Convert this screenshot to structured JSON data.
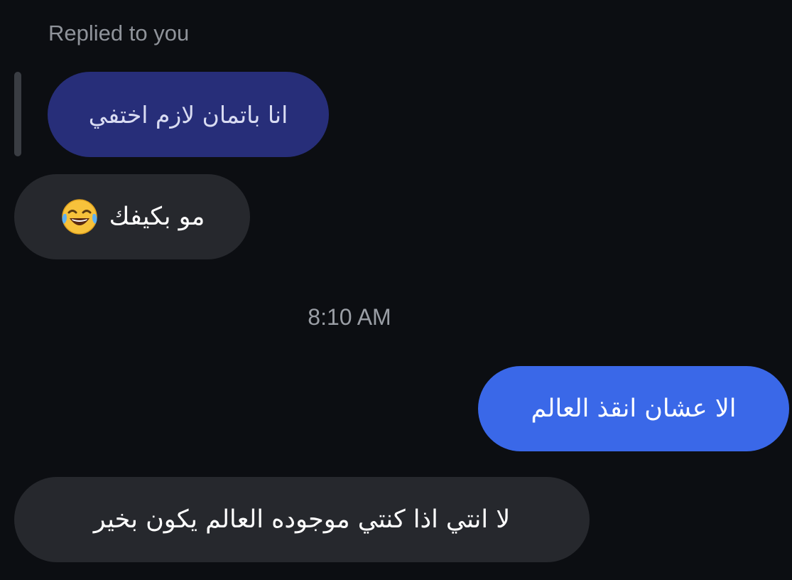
{
  "reply": {
    "label": "Replied to you",
    "quoted_text": "انا باتمان لازم اختفي"
  },
  "messages": [
    {
      "direction": "incoming",
      "text": "مو بكيفك",
      "emoji": "face-with-tears-of-joy"
    },
    {
      "direction": "outgoing",
      "text": "الا عشان انقذ العالم"
    },
    {
      "direction": "incoming",
      "text": "لا انتي اذا كنتي موجوده العالم يكون بخير"
    }
  ],
  "timestamp": "8:10 AM",
  "colors": {
    "background": "#0c0e12",
    "incoming_bubble": "#26282d",
    "outgoing_bubble": "#3a68e8",
    "quoted_bubble": "#272e79",
    "secondary_text": "#8f939a"
  }
}
